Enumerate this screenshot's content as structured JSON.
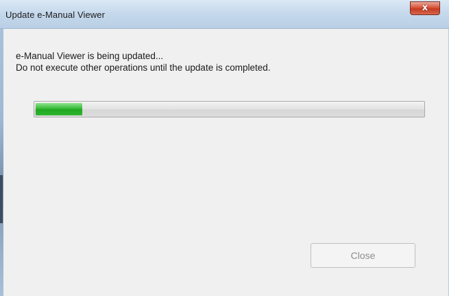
{
  "window": {
    "title": "Update e-Manual Viewer",
    "close_glyph": "x",
    "close_icon": "close-icon"
  },
  "message": {
    "line1": "e-Manual Viewer is being updated...",
    "line2": "Do not execute other operations until the update is completed."
  },
  "progress": {
    "value_percent": 12,
    "color": "#2cb52c"
  },
  "buttons": {
    "close_label": "Close",
    "close_enabled": false
  }
}
